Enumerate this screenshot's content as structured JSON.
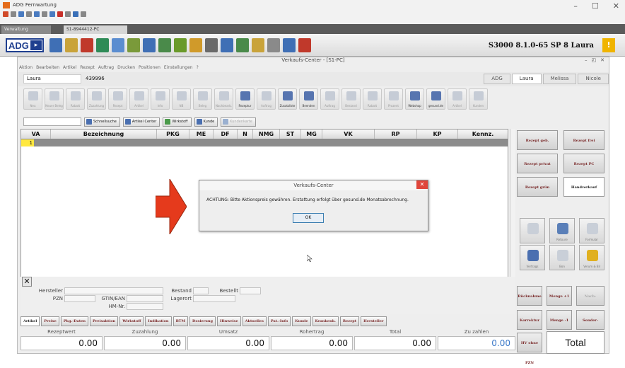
{
  "outer": {
    "app_name": "ADG Fernwartung",
    "tabs": [
      "Verwaltung",
      "S1-8944412-PC"
    ]
  },
  "toolbar": {
    "version": "S3000 8.1.0-65 SP 8 Laura",
    "badge": "!"
  },
  "window": {
    "title": "Verkaufs-Center - [S1-PC]",
    "menu": [
      "Aktion",
      "Bearbeiten",
      "Artikel",
      "Rezept",
      "Auftrag",
      "Drucken",
      "Positionen",
      "Einstellungen",
      "?"
    ]
  },
  "user": {
    "name": "Laura",
    "id": "439996",
    "tabs": [
      "ADG",
      "Laura",
      "Melissa",
      "Nicole"
    ]
  },
  "func_icons": [
    {
      "label": "Neu",
      "icon": "new-icon",
      "on": false
    },
    {
      "label": "Neuer Beleg",
      "icon": "doc-icon",
      "on": false
    },
    {
      "label": "Rabatt",
      "icon": "percent-icon",
      "on": false
    },
    {
      "label": "Zuzahlung",
      "icon": "pen-icon",
      "on": false
    },
    {
      "label": "Rezept",
      "icon": "rx-icon",
      "on": false
    },
    {
      "label": "Artikel",
      "icon": "box-icon",
      "on": false
    },
    {
      "label": "Info",
      "icon": "info-icon",
      "on": false
    },
    {
      "label": "NB",
      "icon": "nb-icon",
      "on": false
    },
    {
      "label": "Beleg",
      "icon": "receipt-icon",
      "on": false
    },
    {
      "label": "Nachbearb.",
      "icon": "edit-icon",
      "on": false
    },
    {
      "label": "Rezeptur",
      "icon": "mortar-icon",
      "on": true
    },
    {
      "label": "Auftrag",
      "icon": "order-icon",
      "on": false
    },
    {
      "label": "Zusatzliste",
      "icon": "list-icon",
      "on": true
    },
    {
      "label": "Beenden",
      "icon": "exit-icon",
      "on": true
    },
    {
      "label": "Auftrag",
      "icon": "order2-icon",
      "on": false
    },
    {
      "label": "Bestand",
      "icon": "stock-icon",
      "on": false
    },
    {
      "label": "Rabatt",
      "icon": "discount-icon",
      "on": false
    },
    {
      "label": "Prozent",
      "icon": "percent2-icon",
      "on": false
    },
    {
      "label": "Webshop",
      "icon": "webshop-icon",
      "on": true
    },
    {
      "label": "gesund.de",
      "icon": "gesund-icon",
      "on": true
    },
    {
      "label": "Artikel",
      "icon": "art-icon",
      "on": false
    },
    {
      "label": "Kunden",
      "icon": "customer-icon",
      "on": false
    }
  ],
  "search_buttons": [
    "Schnellsuche",
    "Artikel Center",
    "Wirkstoff",
    "Kunde",
    "Kundenkarte"
  ],
  "grid": {
    "columns": [
      "VA",
      "Bezeichnung",
      "PKG",
      "ME",
      "DF",
      "N",
      "NMG",
      "ST",
      "MG",
      "VK",
      "RP",
      "KP",
      "Kennz."
    ],
    "first_row_num": "1"
  },
  "right_buttons": {
    "rezept_geb": "Rezept geb.",
    "rezept_frei": "Rezept frei",
    "rezept_privat": "Rezept privat",
    "rezept_pc": "Rezept PC",
    "rezept_gruen": "Rezept grün",
    "handverkauf": "Handverkauf",
    "ruecknahme": "Rücknahme",
    "menge_plus": "Menge +1",
    "nachlieferung": "Nach-lieferung",
    "korrektur": "Korrektur",
    "menge_minus": "Menge -1",
    "sonderposition": "Sonder-position",
    "ohne_pzn": "HV ohne PZN",
    "total": "Total"
  },
  "right_icons": [
    "Dauer",
    "Retoure",
    "Formular",
    "Vertrags",
    "Bon",
    "Verum & Bil"
  ],
  "details": {
    "hersteller": "Hersteller",
    "pzn": "PZN",
    "gtin": "GTIN/EAN",
    "hmnr": "HM-Nr.",
    "bestand": "Bestand",
    "lagerort": "Lagerort",
    "bestellt": "Bestellt"
  },
  "bottom_tabs": [
    "Artikel",
    "Preise",
    "Pkg.-Daten",
    "Preisaktion",
    "Wirkstoff",
    "Indikation",
    "BTM",
    "Dosierung",
    "Hinweise",
    "Aktuelles",
    "Pat.-Info",
    "Kunde",
    "Krankenk.",
    "Rezept",
    "Hersteller"
  ],
  "totals": [
    {
      "label": "Rezeptwert",
      "value": "0.00"
    },
    {
      "label": "Zuzahlung",
      "value": "0.00"
    },
    {
      "label": "Umsatz",
      "value": "0.00"
    },
    {
      "label": "Rohertrag",
      "value": "0.00"
    },
    {
      "label": "Total",
      "value": "0.00"
    },
    {
      "label": "Zu zahlen",
      "value": "0.00"
    }
  ],
  "dialog": {
    "title": "Verkaufs-Center",
    "message": "ACHTUNG: Bitte Aktionspreis gewähren. Erstattung erfolgt über gesund.de Monatsabrechnung.",
    "ok": "OK"
  },
  "colors": {
    "accent": "#1f3f8f",
    "arrow": "#e53a1c",
    "highlight": "#ffe840",
    "zu_zahlen": "#3a78c8"
  }
}
